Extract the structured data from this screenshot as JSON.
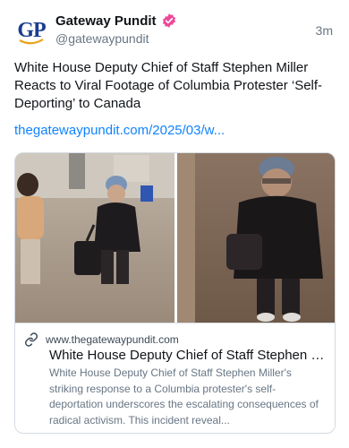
{
  "author": {
    "name": "Gateway Pundit",
    "handle": "@gatewaypundit",
    "avatar_text": "GP",
    "verified": true,
    "brand_color": "#1a3d8f",
    "verified_color": "#ec4899"
  },
  "post": {
    "timestamp": "3m",
    "text": "White House Deputy Chief of Staff Stephen Miller Reacts to Viral Footage of Columbia Protester ‘Self-Deporting’ to Canada",
    "link": "thegatewaypundit.com/2025/03/w..."
  },
  "card": {
    "domain": "www.thegatewaypundit.com",
    "title": "White House Deputy Chief of Staff Stephen Mil...",
    "description": "White House Deputy Chief of Staff Stephen Miller's striking response to a Columbia protester's self-deportation underscores the escalating consequences of radical activism. This incident reveal...",
    "link_icon": "link-icon"
  },
  "colors": {
    "link": "#1083fe",
    "text_secondary": "#687684",
    "border": "#d4dbe2"
  }
}
